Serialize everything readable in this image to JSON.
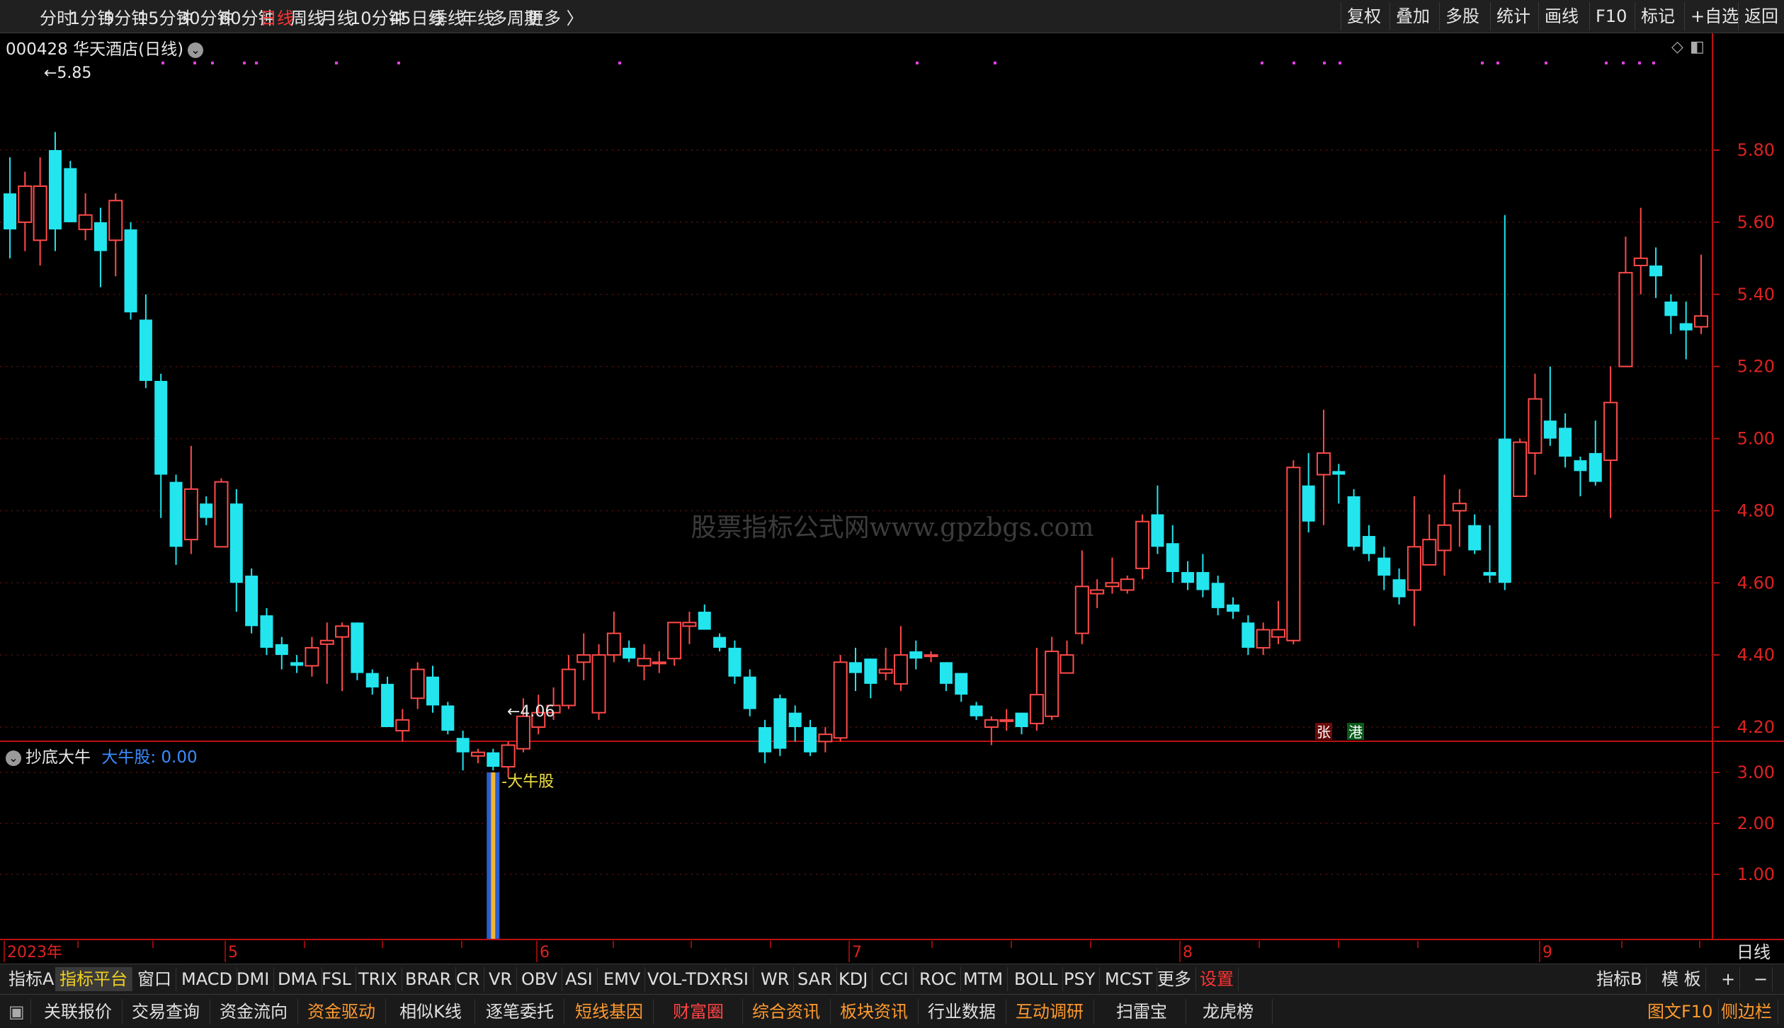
{
  "toolbar": {
    "periods": [
      {
        "label": "分时",
        "active": false
      },
      {
        "label": "1分钟",
        "active": false
      },
      {
        "label": "5分钟",
        "active": false
      },
      {
        "label": "15分钟",
        "active": false
      },
      {
        "label": "30分钟",
        "active": false
      },
      {
        "label": "60分钟",
        "active": false
      },
      {
        "label": "日线",
        "active": true
      },
      {
        "label": "周线",
        "active": false
      },
      {
        "label": "月线",
        "active": false
      },
      {
        "label": "10分钟",
        "active": false
      },
      {
        "label": "45日线",
        "active": false
      },
      {
        "label": "季线",
        "active": false
      },
      {
        "label": "年线",
        "active": false
      },
      {
        "label": "多周期",
        "active": false
      },
      {
        "label": "更多 〉",
        "active": false
      }
    ],
    "right_buttons": [
      "复权",
      "叠加",
      "多股",
      "统计",
      "画线",
      "F10",
      "标记",
      "+自选",
      "返回"
    ]
  },
  "stock": {
    "title": "000428 华天酒店(日线)"
  },
  "watermark": "股票指标公式网www.gpzbgs.com",
  "chart_data": {
    "type": "candlestick",
    "y_axis": {
      "ticks": [
        "5.80",
        "5.60",
        "5.40",
        "5.20",
        "5.00",
        "4.80",
        "4.60",
        "4.40",
        "4.20"
      ],
      "ylim": [
        4.06,
        5.85
      ]
    },
    "annotations": {
      "high": "5.85",
      "low": "4.06"
    },
    "candles": [
      [
        5.68,
        5.58,
        5.78,
        5.5
      ],
      [
        5.6,
        5.7,
        5.74,
        5.52
      ],
      [
        5.55,
        5.7,
        5.78,
        5.48
      ],
      [
        5.8,
        5.58,
        5.85,
        5.52
      ],
      [
        5.75,
        5.6,
        5.77,
        5.6
      ],
      [
        5.58,
        5.62,
        5.68,
        5.55
      ],
      [
        5.6,
        5.52,
        5.64,
        5.42
      ],
      [
        5.55,
        5.66,
        5.68,
        5.45
      ],
      [
        5.58,
        5.35,
        5.6,
        5.33
      ],
      [
        5.33,
        5.16,
        5.4,
        5.14
      ],
      [
        5.16,
        4.9,
        5.18,
        4.78
      ],
      [
        4.88,
        4.7,
        4.9,
        4.65
      ],
      [
        4.72,
        4.86,
        4.98,
        4.68
      ],
      [
        4.82,
        4.78,
        4.84,
        4.76
      ],
      [
        4.7,
        4.88,
        4.89,
        4.7
      ],
      [
        4.82,
        4.6,
        4.86,
        4.52
      ],
      [
        4.62,
        4.48,
        4.64,
        4.46
      ],
      [
        4.51,
        4.42,
        4.53,
        4.4
      ],
      [
        4.43,
        4.4,
        4.45,
        4.36
      ],
      [
        4.38,
        4.37,
        4.4,
        4.35
      ],
      [
        4.37,
        4.42,
        4.45,
        4.34
      ],
      [
        4.43,
        4.44,
        4.49,
        4.32
      ],
      [
        4.45,
        4.48,
        4.49,
        4.3
      ],
      [
        4.49,
        4.35,
        4.49,
        4.33
      ],
      [
        4.35,
        4.31,
        4.36,
        4.29
      ],
      [
        4.32,
        4.2,
        4.34,
        4.2
      ],
      [
        4.19,
        4.22,
        4.25,
        4.16
      ],
      [
        4.28,
        4.36,
        4.38,
        4.25
      ],
      [
        4.34,
        4.26,
        4.37,
        4.24
      ],
      [
        4.26,
        4.19,
        4.27,
        4.18
      ],
      [
        4.17,
        4.13,
        4.19,
        4.08
      ],
      [
        4.12,
        4.13,
        4.14,
        4.1
      ],
      [
        4.13,
        4.09,
        4.14,
        4.08
      ],
      [
        4.09,
        4.15,
        4.16,
        4.06
      ],
      [
        4.14,
        4.23,
        4.28,
        4.13
      ],
      [
        4.2,
        4.24,
        4.29,
        4.18
      ],
      [
        4.24,
        4.26,
        4.31,
        4.22
      ],
      [
        4.26,
        4.36,
        4.4,
        4.25
      ],
      [
        4.38,
        4.4,
        4.46,
        4.33
      ],
      [
        4.24,
        4.4,
        4.43,
        4.22
      ],
      [
        4.4,
        4.46,
        4.52,
        4.38
      ],
      [
        4.42,
        4.39,
        4.44,
        4.38
      ],
      [
        4.37,
        4.39,
        4.43,
        4.33
      ],
      [
        4.38,
        4.38,
        4.41,
        4.35
      ],
      [
        4.39,
        4.49,
        4.47,
        4.37
      ],
      [
        4.48,
        4.49,
        4.52,
        4.43
      ],
      [
        4.52,
        4.47,
        4.54,
        4.48
      ],
      [
        4.45,
        4.42,
        4.46,
        4.41
      ],
      [
        4.42,
        4.34,
        4.44,
        4.32
      ],
      [
        4.34,
        4.25,
        4.36,
        4.23
      ],
      [
        4.2,
        4.13,
        4.22,
        4.1
      ],
      [
        4.28,
        4.14,
        4.29,
        4.12
      ],
      [
        4.24,
        4.2,
        4.26,
        4.16
      ],
      [
        4.2,
        4.13,
        4.22,
        4.12
      ],
      [
        4.16,
        4.18,
        4.2,
        4.13
      ],
      [
        4.17,
        4.38,
        4.4,
        4.16
      ],
      [
        4.38,
        4.35,
        4.42,
        4.3
      ],
      [
        4.39,
        4.32,
        4.39,
        4.28
      ],
      [
        4.35,
        4.36,
        4.42,
        4.33
      ],
      [
        4.32,
        4.4,
        4.48,
        4.3
      ],
      [
        4.41,
        4.39,
        4.44,
        4.36
      ],
      [
        4.4,
        4.4,
        4.41,
        4.38
      ],
      [
        4.38,
        4.32,
        4.38,
        4.3
      ],
      [
        4.35,
        4.29,
        4.35,
        4.27
      ],
      [
        4.26,
        4.23,
        4.27,
        4.22
      ],
      [
        4.2,
        4.22,
        4.23,
        4.15
      ],
      [
        4.22,
        4.22,
        4.25,
        4.19
      ],
      [
        4.24,
        4.2,
        4.24,
        4.18
      ],
      [
        4.21,
        4.29,
        4.42,
        4.19
      ],
      [
        4.23,
        4.41,
        4.45,
        4.22
      ],
      [
        4.35,
        4.4,
        4.44,
        4.35
      ],
      [
        4.46,
        4.59,
        4.69,
        4.43
      ],
      [
        4.57,
        4.58,
        4.61,
        4.53
      ],
      [
        4.59,
        4.6,
        4.67,
        4.57
      ],
      [
        4.58,
        4.61,
        4.62,
        4.57
      ],
      [
        4.64,
        4.77,
        4.79,
        4.61
      ],
      [
        4.79,
        4.7,
        4.87,
        4.68
      ],
      [
        4.71,
        4.63,
        4.76,
        4.6
      ],
      [
        4.63,
        4.6,
        4.66,
        4.58
      ],
      [
        4.63,
        4.58,
        4.68,
        4.56
      ],
      [
        4.6,
        4.53,
        4.62,
        4.51
      ],
      [
        4.54,
        4.52,
        4.56,
        4.5
      ],
      [
        4.49,
        4.42,
        4.51,
        4.4
      ],
      [
        4.42,
        4.47,
        4.49,
        4.4
      ],
      [
        4.45,
        4.47,
        4.55,
        4.43
      ],
      [
        4.44,
        4.92,
        4.94,
        4.43
      ],
      [
        4.87,
        4.77,
        4.96,
        4.74
      ],
      [
        4.9,
        4.96,
        5.08,
        4.76
      ],
      [
        4.91,
        4.9,
        4.93,
        4.82
      ],
      [
        4.84,
        4.7,
        4.86,
        4.69
      ],
      [
        4.73,
        4.68,
        4.76,
        4.66
      ],
      [
        4.67,
        4.62,
        4.7,
        4.58
      ],
      [
        4.61,
        4.56,
        4.64,
        4.54
      ],
      [
        4.58,
        4.7,
        4.84,
        4.48
      ],
      [
        4.65,
        4.72,
        4.79,
        4.65
      ],
      [
        4.69,
        4.76,
        4.9,
        4.62
      ],
      [
        4.8,
        4.82,
        4.86,
        4.7
      ],
      [
        4.76,
        4.69,
        4.79,
        4.68
      ],
      [
        4.63,
        4.62,
        4.76,
        4.6
      ],
      [
        5.0,
        4.6,
        5.62,
        4.58
      ],
      [
        4.84,
        4.99,
        5.0,
        4.84
      ],
      [
        4.96,
        5.11,
        5.18,
        4.9
      ],
      [
        5.05,
        5.0,
        5.2,
        4.98
      ],
      [
        5.03,
        4.95,
        5.07,
        4.92
      ],
      [
        4.94,
        4.91,
        4.95,
        4.84
      ],
      [
        4.96,
        4.88,
        5.05,
        4.87
      ],
      [
        4.94,
        5.1,
        5.2,
        4.78
      ],
      [
        5.2,
        5.46,
        5.56,
        5.2
      ],
      [
        5.48,
        5.5,
        5.64,
        5.4
      ],
      [
        5.48,
        5.45,
        5.53,
        5.39
      ],
      [
        5.38,
        5.34,
        5.4,
        5.29
      ],
      [
        5.32,
        5.3,
        5.38,
        5.22
      ],
      [
        5.31,
        5.34,
        5.51,
        5.29
      ]
    ],
    "subchart": {
      "title": "抄底大牛",
      "series_label": "大牛股: 0.00",
      "signal_label": "大牛股",
      "signal_index": 32,
      "signal_value": 3.0,
      "y_ticks": [
        "3.00",
        "2.00",
        "1.00"
      ]
    },
    "time_axis": {
      "labels": [
        "2023年",
        "5",
        "6",
        "7",
        "8",
        "9"
      ],
      "period_label": "日线"
    }
  },
  "badges": {
    "zhang": "张",
    "gang": "港"
  },
  "indicator_bar": {
    "items": [
      "指标A",
      "指标平台",
      "窗口",
      "MACD",
      "DMI",
      "DMA",
      "FSL",
      "TRIX",
      "BRAR",
      "CR",
      "VR",
      "OBV",
      "ASI",
      "EMV",
      "VOL-TDX",
      "RSI",
      "WR",
      "SAR",
      "KDJ",
      "CCI",
      "ROC",
      "MTM",
      "BOLL",
      "PSY",
      "MCST",
      "更多",
      "设置"
    ],
    "highlight": "指标平台",
    "red": "设置",
    "right": [
      "指标B",
      "模 板",
      "+",
      "−"
    ]
  },
  "function_bar": {
    "items": [
      {
        "label": "关联报价",
        "color": "#e0e0e0"
      },
      {
        "label": "交易查询",
        "color": "#e0e0e0"
      },
      {
        "label": "资金流向",
        "color": "#e0e0e0"
      },
      {
        "label": "资金驱动",
        "color": "#ff9a2e"
      },
      {
        "label": "相似K线",
        "color": "#e0e0e0"
      },
      {
        "label": "逐笔委托",
        "color": "#e0e0e0"
      },
      {
        "label": "短线基因",
        "color": "#ff9a2e"
      },
      {
        "label": "财富圈",
        "color": "#ff4444"
      },
      {
        "label": "综合资讯",
        "color": "#ff9a2e"
      },
      {
        "label": "板块资讯",
        "color": "#ff9a2e"
      },
      {
        "label": "行业数据",
        "color": "#e0e0e0"
      },
      {
        "label": "互动调研",
        "color": "#ff9a2e"
      },
      {
        "label": "扫雷宝",
        "color": "#e0e0e0"
      },
      {
        "label": "龙虎榜",
        "color": "#e0e0e0"
      }
    ],
    "right": [
      "图文F10",
      "侧边栏"
    ]
  }
}
